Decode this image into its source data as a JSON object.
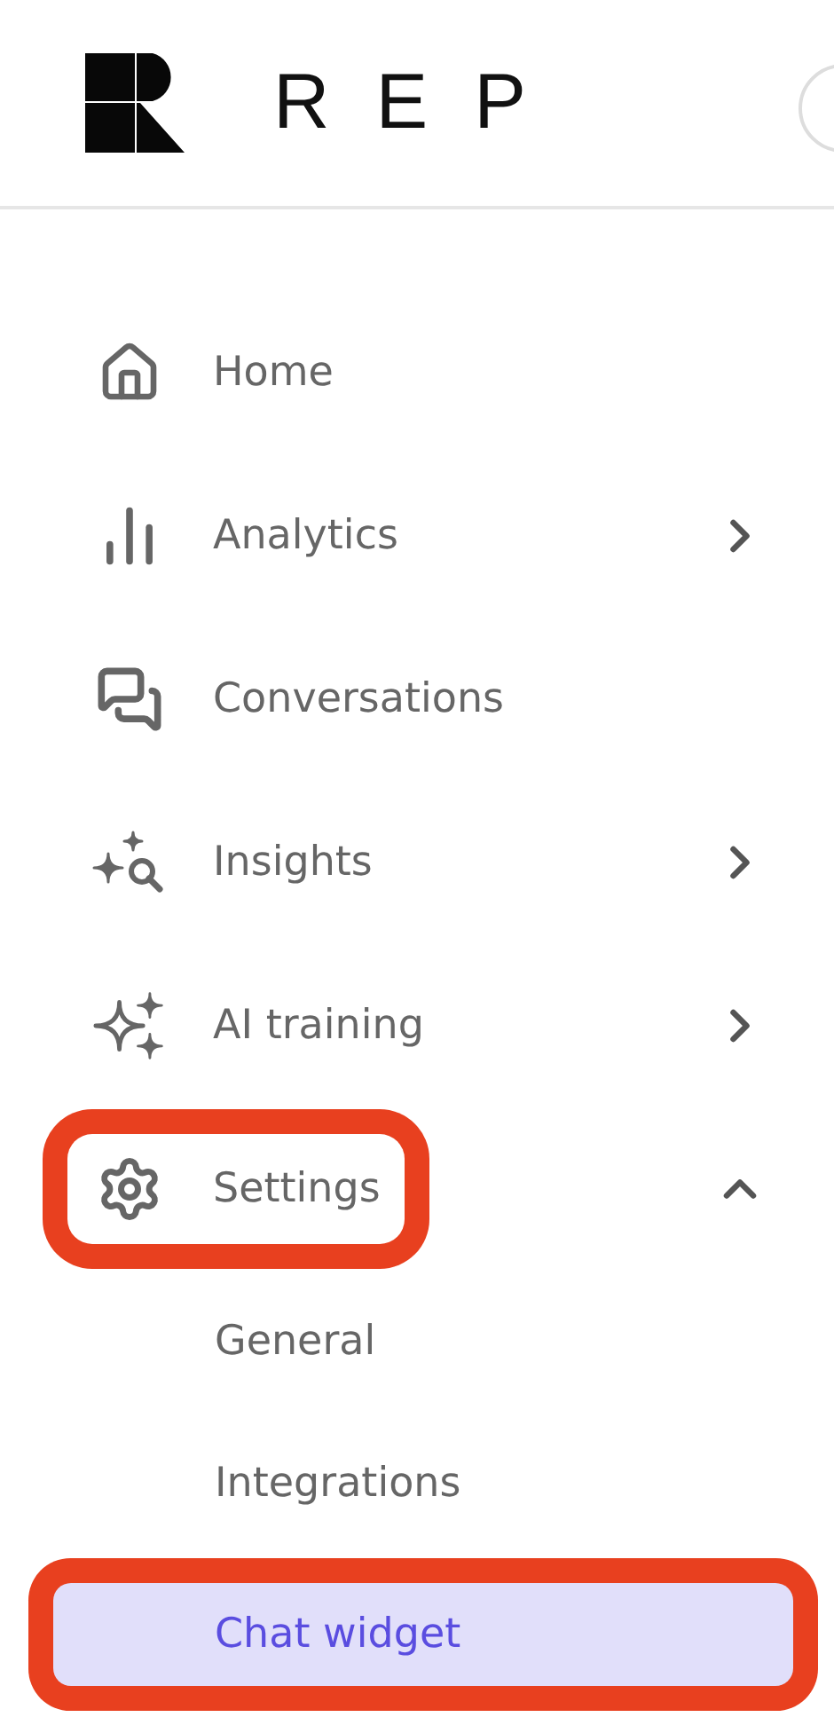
{
  "brand": {
    "name": "REP"
  },
  "nav": [
    {
      "label": "Home",
      "highlighted": false
    },
    {
      "label": "Analytics",
      "expanded": false,
      "highlighted": false
    },
    {
      "label": "Conversations",
      "highlighted": false
    },
    {
      "label": "Insights",
      "expanded": false,
      "highlighted": false
    },
    {
      "label": "AI training",
      "expanded": false,
      "highlighted": false
    },
    {
      "label": "Settings",
      "expanded": true,
      "highlighted": true,
      "children": [
        {
          "label": "General",
          "selected": false,
          "highlighted": false
        },
        {
          "label": "Integrations",
          "selected": false,
          "highlighted": false
        },
        {
          "label": "Chat widget",
          "selected": true,
          "highlighted": true
        }
      ]
    }
  ]
}
